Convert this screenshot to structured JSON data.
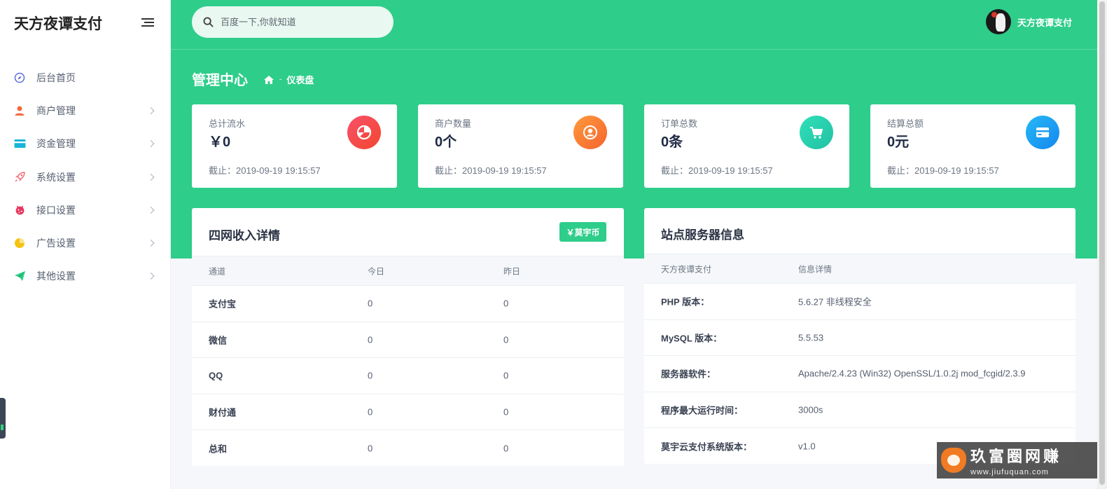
{
  "sidebar": {
    "brand": "天方夜谭支付",
    "items": [
      {
        "label": "后台首页",
        "icon": "compass-icon",
        "color": "#5b6fdb",
        "has_arrow": false
      },
      {
        "label": "商户管理",
        "icon": "user-icon",
        "color": "#f46a3c",
        "has_arrow": true
      },
      {
        "label": "资金管理",
        "icon": "card-icon",
        "color": "#19b5d8",
        "has_arrow": true
      },
      {
        "label": "系统设置",
        "icon": "rocket-icon",
        "color": "#f26b73",
        "has_arrow": true
      },
      {
        "label": "接口设置",
        "icon": "bug-icon",
        "color": "#e8345e",
        "has_arrow": true
      },
      {
        "label": "广告设置",
        "icon": "pie-chart-icon",
        "color": "#f5c20f",
        "has_arrow": true
      },
      {
        "label": "其他设置",
        "icon": "send-icon",
        "color": "#2ecd8a",
        "has_arrow": true
      }
    ]
  },
  "header": {
    "search_placeholder": "百度一下,你就知道",
    "user_name": "天方夜谭支付"
  },
  "page": {
    "title": "管理中心",
    "breadcrumb": "仪表盘"
  },
  "stats": [
    {
      "label": "总计流水",
      "value": "￥0",
      "date": "截止：2019-09-19 19:15:57",
      "icon": "pie-chart-icon",
      "color_from": "#f9506a",
      "color_to": "#f2472e"
    },
    {
      "label": "商户数量",
      "value": "0个",
      "date": "截止：2019-09-19 19:15:57",
      "icon": "user-circle-icon",
      "color_from": "#ff9a3c",
      "color_to": "#f5632e"
    },
    {
      "label": "订单总数",
      "value": "0条",
      "date": "截止：2019-09-19 19:15:57",
      "icon": "cart-icon",
      "color_from": "#2fe0b8",
      "color_to": "#22c1a4"
    },
    {
      "label": "结算总额",
      "value": "0元",
      "date": "截止：2019-09-19 19:15:57",
      "icon": "credit-card-icon",
      "color_from": "#26b8f5",
      "color_to": "#1588ef"
    }
  ],
  "income": {
    "title": "四网收入详情",
    "badge": "￥莫宇币",
    "headers": [
      "通道",
      "今日",
      "昨日"
    ],
    "rows": [
      {
        "channel": "支付宝",
        "today": "0",
        "yesterday": "0"
      },
      {
        "channel": "微信",
        "today": "0",
        "yesterday": "0"
      },
      {
        "channel": "QQ",
        "today": "0",
        "yesterday": "0"
      },
      {
        "channel": "财付通",
        "today": "0",
        "yesterday": "0"
      },
      {
        "channel": "总和",
        "today": "0",
        "yesterday": "0"
      }
    ]
  },
  "server": {
    "title": "站点服务器信息",
    "headers": [
      "天方夜谭支付",
      "信息详情"
    ],
    "rows": [
      {
        "key": "PHP 版本：",
        "value": "5.6.27 非线程安全"
      },
      {
        "key": "MySQL 版本：",
        "value": "5.5.53"
      },
      {
        "key": "服务器软件：",
        "value": "Apache/2.4.23 (Win32) OpenSSL/1.0.2j mod_fcgid/2.3.9"
      },
      {
        "key": "程序最大运行时间：",
        "value": "3000s"
      },
      {
        "key": "莫宇云支付系统版本：",
        "value": "v1.0"
      }
    ]
  },
  "watermark": {
    "title": "玖富圈网赚",
    "url": "www.jiufuquan.com"
  }
}
